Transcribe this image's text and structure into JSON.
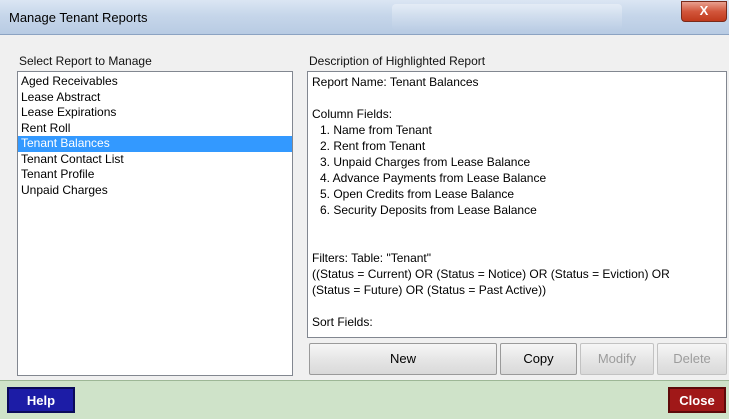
{
  "window": {
    "title": "Manage Tenant Reports",
    "close_glyph": "X"
  },
  "left": {
    "label": "Select Report to Manage",
    "items": [
      "Aged Receivables",
      "Lease Abstract",
      "Lease Expirations",
      "Rent Roll",
      "Tenant Balances",
      "Tenant Contact List",
      "Tenant Profile",
      "Unpaid Charges"
    ],
    "selected_index": 4
  },
  "right": {
    "label": "Description of Highlighted Report",
    "report_name": "Report Name: Tenant Balances",
    "column_fields_label": "Column Fields:",
    "fields": [
      "1. Name from Tenant",
      "2. Rent from Tenant",
      "3. Unpaid Charges from Lease Balance",
      "4. Advance Payments from Lease Balance",
      "5. Open Credits from Lease Balance",
      "6. Security Deposits from Lease Balance"
    ],
    "filters_label": "Filters: Table: \"Tenant\"",
    "filter_line1": "((Status = Current) OR (Status = Notice) OR (Status = Eviction) OR",
    "filter_line2": "(Status = Future) OR (Status = Past Active))",
    "sort_label": "Sort Fields:"
  },
  "buttons": {
    "new": "New",
    "copy": "Copy",
    "modify": "Modify",
    "delete": "Delete"
  },
  "footer": {
    "help": "Help",
    "close": "Close"
  },
  "colors": {
    "selection": "#3399ff",
    "footer_bg": "#cfe3c9",
    "help_btn": "#1c1ca6",
    "close_btn": "#a01818"
  }
}
